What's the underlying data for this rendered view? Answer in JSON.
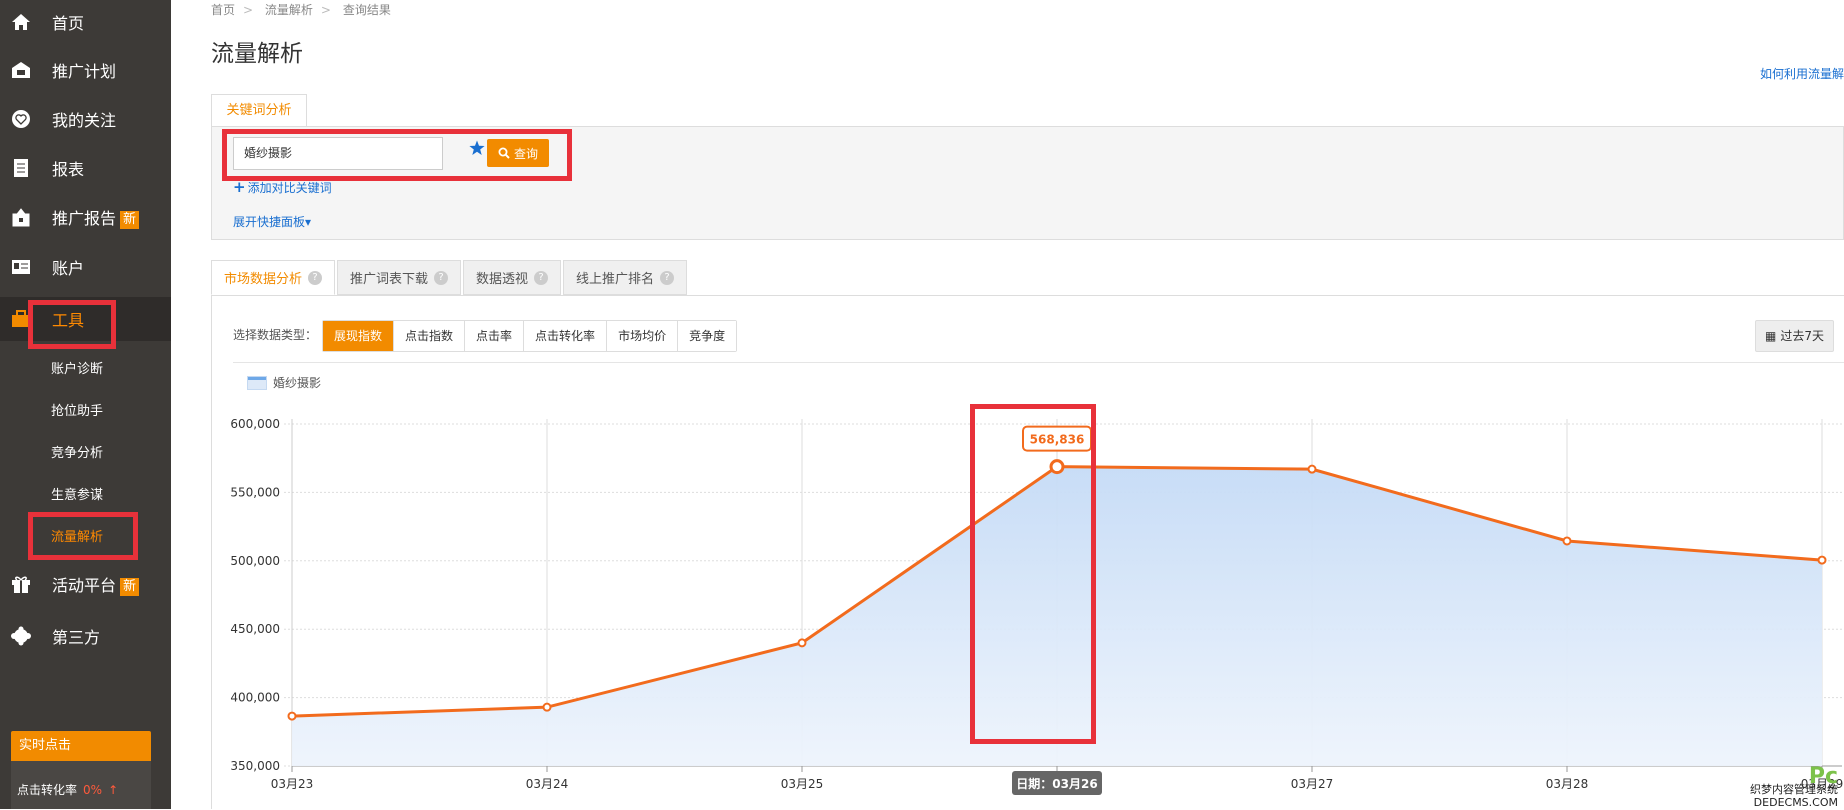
{
  "sidebar": {
    "items": [
      {
        "label": "首页",
        "icon": "home-icon"
      },
      {
        "label": "推广计划",
        "icon": "plan-icon"
      },
      {
        "label": "我的关注",
        "icon": "heart-icon"
      },
      {
        "label": "报表",
        "icon": "report-icon"
      },
      {
        "label": "推广报告",
        "icon": "bag-icon",
        "badge": "新"
      },
      {
        "label": "账户",
        "icon": "account-icon"
      },
      {
        "label": "工具",
        "icon": "toolbox-icon"
      },
      {
        "label": "活动平台",
        "icon": "gift-icon",
        "badge": "新"
      },
      {
        "label": "第三方",
        "icon": "thirdparty-icon"
      }
    ],
    "sub_items": [
      "账户诊断",
      "抢位助手",
      "竞争分析",
      "生意参谋",
      "流量解析"
    ],
    "realtime": {
      "title": "实时点击",
      "metric_label": "点击转化率",
      "metric_value": "0%"
    }
  },
  "breadcrumb": [
    "首页",
    "流量解析",
    "查询结果"
  ],
  "page_title": "流量解析",
  "help_link": "如何利用流量解",
  "keyword_panel": {
    "tab_label": "关键词分析",
    "input_value": "婚纱摄影",
    "query_button": "查询",
    "add_compare": "添加对比关键词",
    "expand_panel": "展开快捷面板"
  },
  "tabs": [
    {
      "label": "市场数据分析",
      "active": true
    },
    {
      "label": "推广词表下载",
      "active": false
    },
    {
      "label": "数据透视",
      "active": false
    },
    {
      "label": "线上推广排名",
      "active": false
    }
  ],
  "data_type": {
    "label": "选择数据类型：",
    "options": [
      "展现指数",
      "点击指数",
      "点击率",
      "点击转化率",
      "市场均价",
      "竞争度"
    ],
    "selected": "展现指数"
  },
  "range_button": "过去7天",
  "colors": {
    "accent": "#f28b00",
    "line": "#f26b1d",
    "area": "#cfe1f8",
    "highlight": "#e8313a"
  },
  "chart_data": {
    "type": "area",
    "series": [
      {
        "name": "婚纱摄影",
        "values": [
          386500,
          393000,
          440000,
          568836,
          567000,
          514500,
          500500
        ]
      }
    ],
    "x": [
      "03月23",
      "03月24",
      "03月25",
      "03月26",
      "03月27",
      "03月28",
      "03月29"
    ],
    "y_ticks": [
      "600,000",
      "550,000",
      "500,000",
      "450,000",
      "400,000",
      "350,000"
    ],
    "ylim": [
      350000,
      600000
    ],
    "tooltip_value": "568,836",
    "tooltip_date": "日期：03月26",
    "grid": true
  },
  "watermark": {
    "brand": "Pc",
    "line1": "织梦内容管理系统",
    "line2": "DEDECMS.COM"
  }
}
